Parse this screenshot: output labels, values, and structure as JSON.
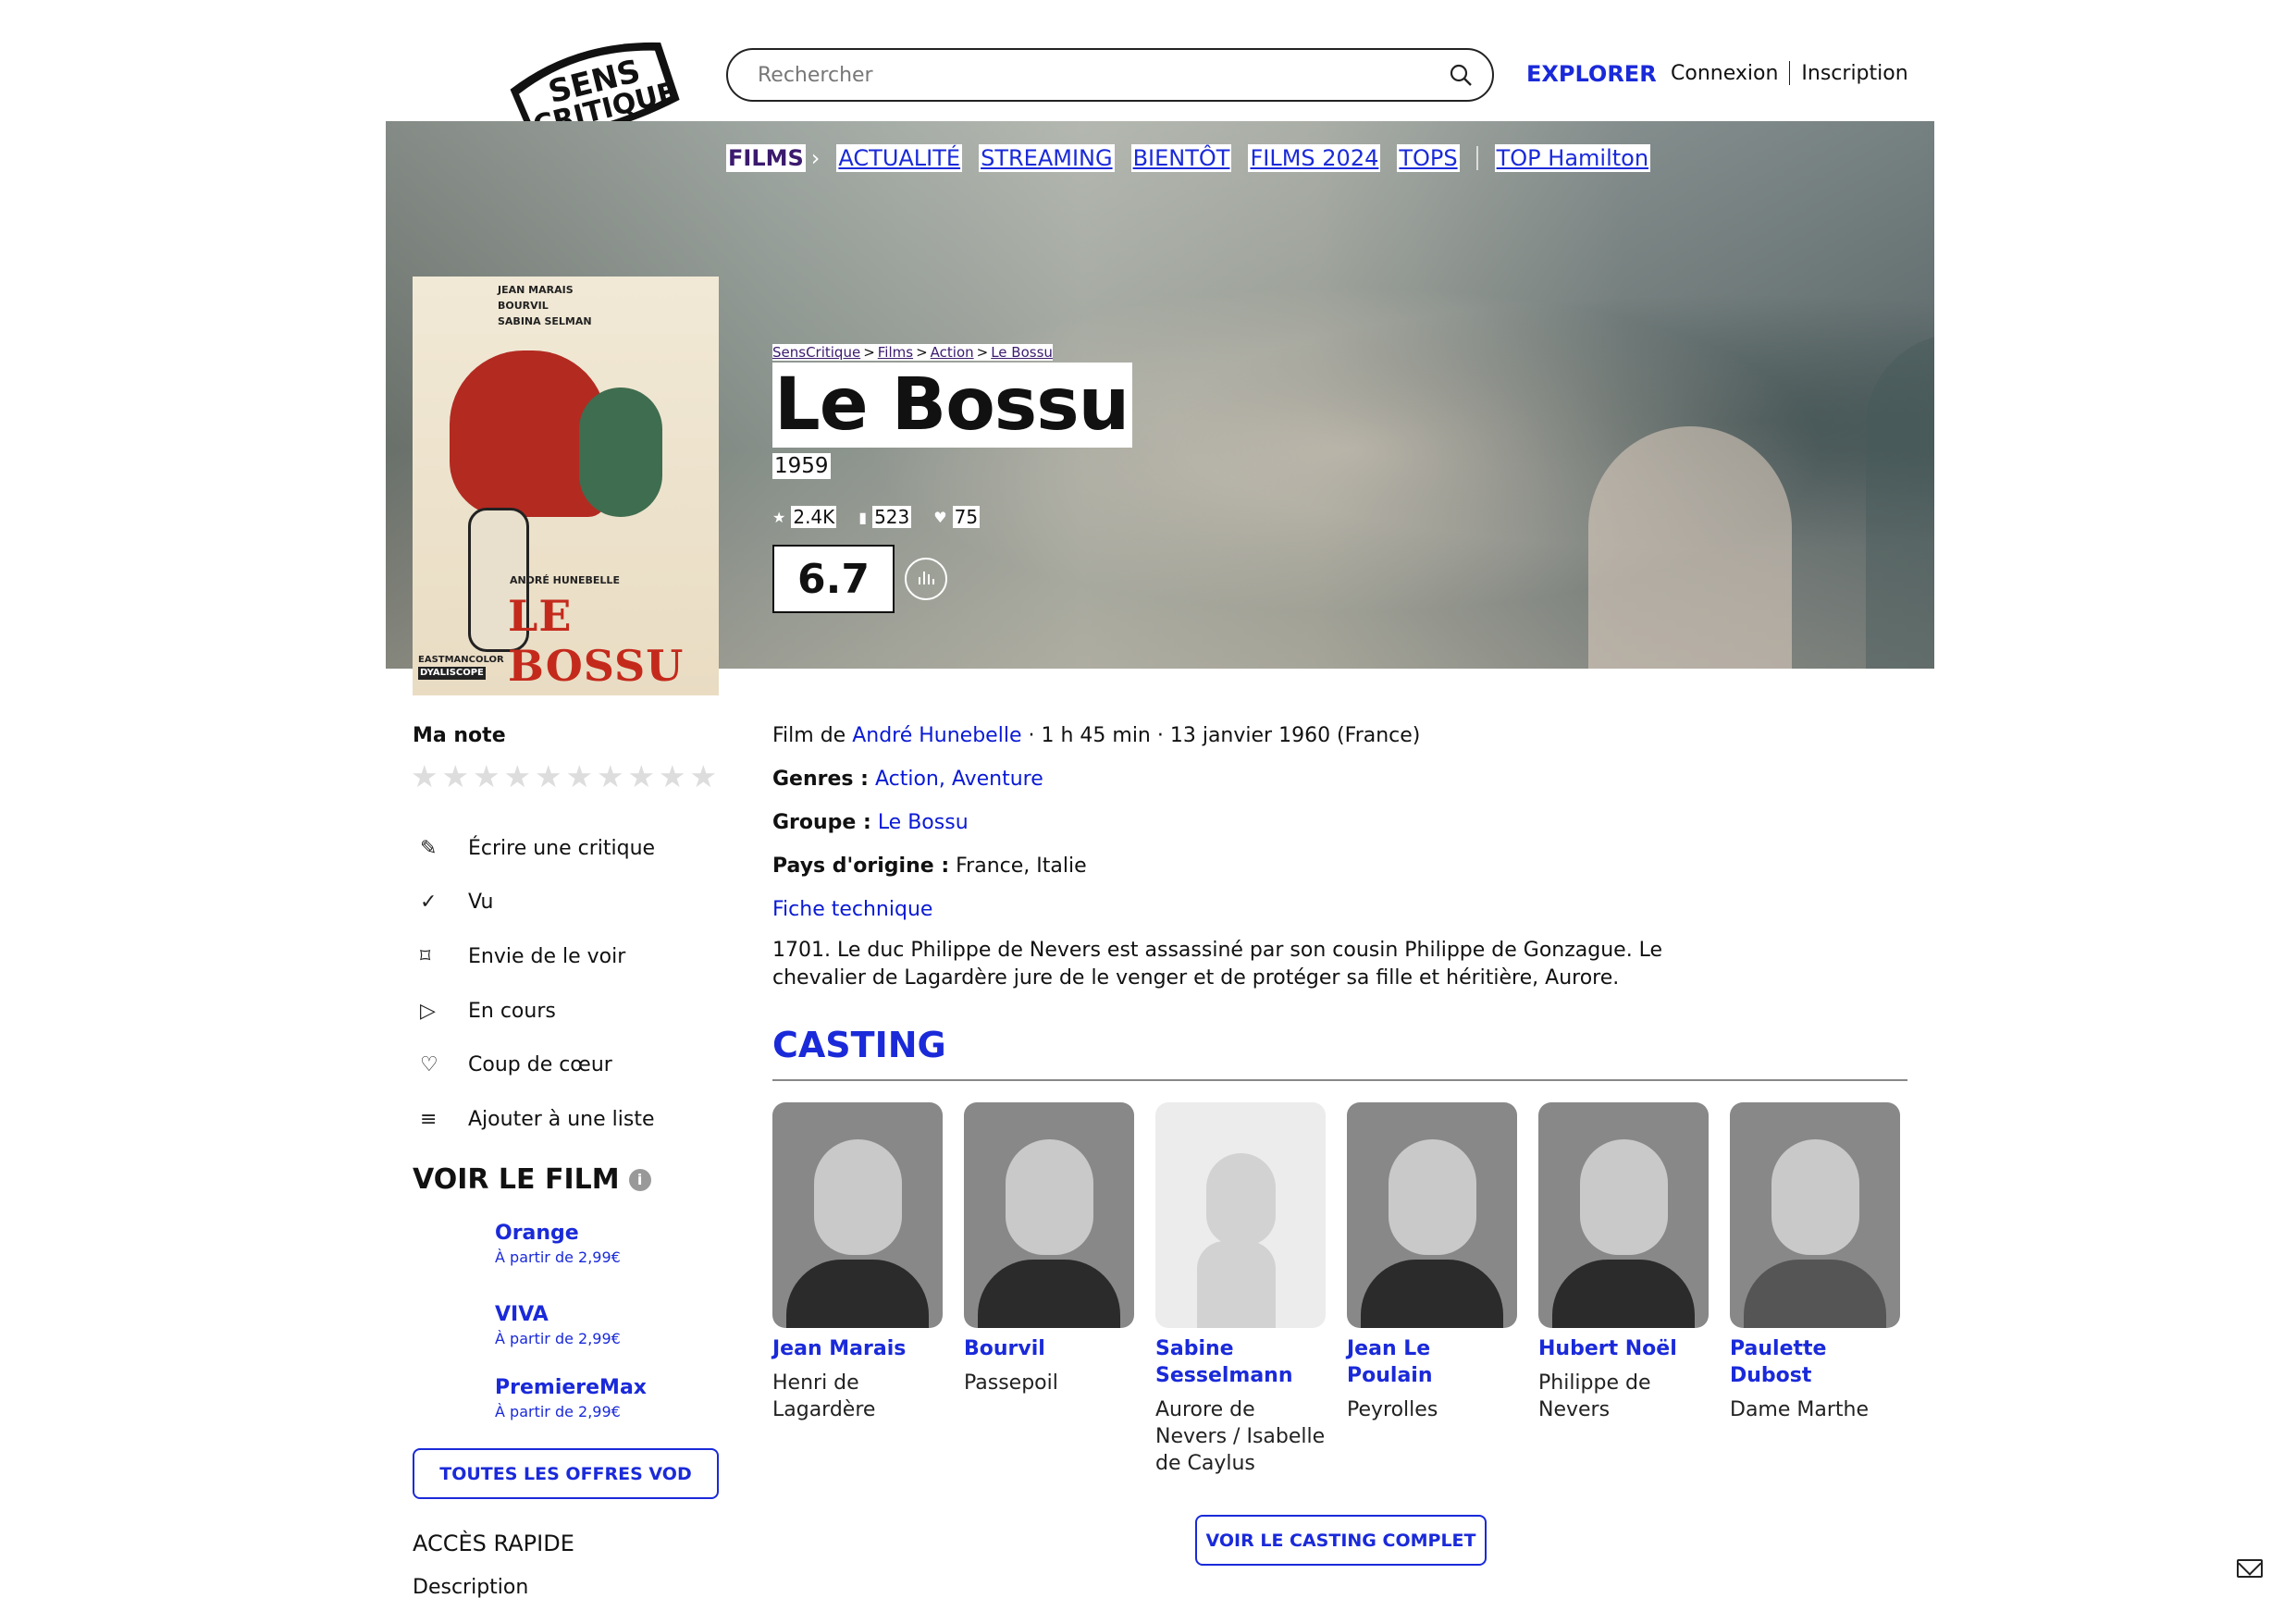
{
  "header": {
    "logo_text": [
      "SENS",
      "CRITIQUE"
    ],
    "search_placeholder": "Rechercher",
    "explorer": "EXPLORER",
    "login": "Connexion",
    "signup": "Inscription"
  },
  "nav": {
    "items": [
      "FILMS",
      "ACTUALITÉ",
      "STREAMING",
      "BIENTÔT",
      "FILMS 2024",
      "TOPS",
      "TOP Hamilton"
    ]
  },
  "breadcrumb": [
    "SensCritique",
    "Films",
    "Action",
    "Le Bossu"
  ],
  "movie": {
    "title": "Le Bossu",
    "year": "1959",
    "stats": {
      "ratings": "2.4K",
      "wishlist": "523",
      "favorites": "75"
    },
    "score": "6.7",
    "poster": {
      "credits": [
        "JEAN MARAIS",
        "BOURVIL",
        "SABINA SELMAN"
      ],
      "director_line": "ANDRÉ HUNEBELLE",
      "title": "LE BOSSU",
      "tech": [
        "EASTMANCOLOR",
        "DYALISCOPE"
      ]
    },
    "info": {
      "film_de_label": "Film de",
      "director": "André Hunebelle",
      "details": "· 1 h 45 min · 13 janvier 1960 (France)",
      "genres_label": "Genres :",
      "genres": "Action, Aventure",
      "groupe_label": "Groupe :",
      "groupe": "Le Bossu",
      "pays_label": "Pays d'origine :",
      "pays": "France, Italie",
      "fiche": "Fiche technique"
    },
    "synopsis": "1701. Le duc Philippe de Nevers est assassiné par son cousin Philippe de Gonzague. Le chevalier de Lagardère jure de le venger et de protéger sa fille et héritière, Aurore."
  },
  "sidebar": {
    "ma_note": "Ma note",
    "actions": [
      {
        "label": "Écrire une critique",
        "icon": "pencil-icon",
        "glyph": "✎"
      },
      {
        "label": "Vu",
        "icon": "check-icon",
        "glyph": "✓"
      },
      {
        "label": "Envie de le voir",
        "icon": "bookmark-icon",
        "glyph": "⌑"
      },
      {
        "label": "En cours",
        "icon": "play-icon",
        "glyph": "▷"
      },
      {
        "label": "Coup de cœur",
        "icon": "heart-icon",
        "glyph": "♡"
      },
      {
        "label": "Ajouter à une liste",
        "icon": "list-add-icon",
        "glyph": "≡"
      }
    ],
    "voir_le_film": "VOIR LE FILM",
    "vod": [
      {
        "name": "Orange",
        "price": "À partir de 2,99€"
      },
      {
        "name": "VIVA",
        "price": "À partir de 2,99€"
      },
      {
        "name": "PremiereMax",
        "price": "À partir de 2,99€"
      }
    ],
    "all_offers": "TOUTES LES OFFRES VOD",
    "acces_rapide": "ACCÈS RAPIDE",
    "description": "Description"
  },
  "casting": {
    "heading": "CASTING",
    "members": [
      {
        "name": "Jean Marais",
        "role": "Henri de Lagardère"
      },
      {
        "name": "Bourvil",
        "role": "Passepoil"
      },
      {
        "name": "Sabine Sesselmann",
        "role": "Aurore de Nevers / Isabelle de Caylus"
      },
      {
        "name": "Jean Le Poulain",
        "role": "Peyrolles"
      },
      {
        "name": "Hubert Noël",
        "role": "Philippe de Nevers"
      },
      {
        "name": "Paulette Dubost",
        "role": "Dame Marthe"
      }
    ],
    "see_all": "VOIR LE CASTING COMPLET"
  },
  "colors": {
    "accent": "#1a2ad9",
    "nav_active": "#3b1a6e"
  }
}
